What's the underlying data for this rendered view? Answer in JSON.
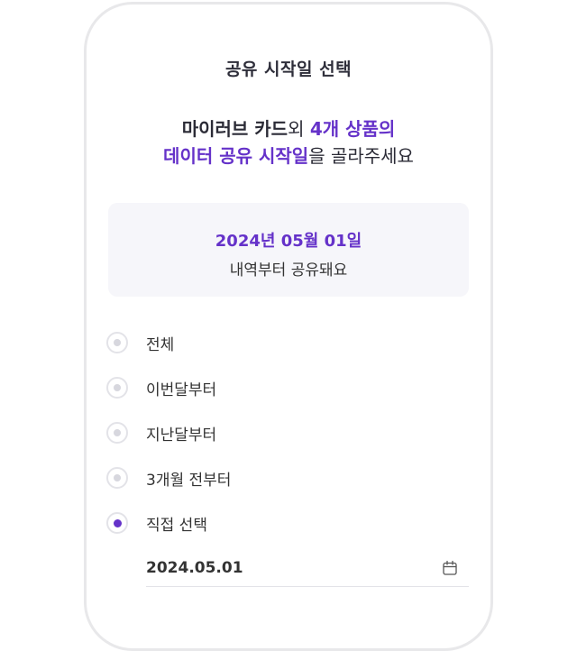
{
  "header": {
    "title": "공유 시작일 선택"
  },
  "headline": {
    "part1_bold": "마이러브 카드",
    "part2": "외 ",
    "part3_purple": "4개 상품의",
    "part4_purple": "데이터 공유 시작일",
    "part5": "을 골라주세요"
  },
  "info": {
    "date": "2024년 05월 01일",
    "sub": "내역부터 공유돼요"
  },
  "options": [
    {
      "label": "전체",
      "selected": false
    },
    {
      "label": "이번달부터",
      "selected": false
    },
    {
      "label": "지난달부터",
      "selected": false
    },
    {
      "label": "3개월 전부터",
      "selected": false
    },
    {
      "label": "직접 선택",
      "selected": true
    }
  ],
  "date_input": {
    "value": "2024.05.01",
    "icon": "calendar-icon"
  },
  "colors": {
    "accent": "#6532c9",
    "radio_border": "#e3e3e8",
    "info_bg": "#f6f6fa"
  }
}
